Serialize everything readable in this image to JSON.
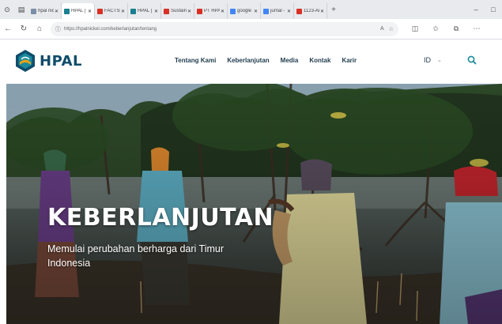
{
  "browser": {
    "tabs": [
      {
        "label": "hpal nick",
        "favicon_color": "#7a8ea6"
      },
      {
        "label": "HPAL | Ke",
        "favicon_color": "#1a7f8f",
        "active": true
      },
      {
        "label": "FACTSHE",
        "favicon_color": "#d93025"
      },
      {
        "label": "HPAL | Ke",
        "favicon_color": "#1a7f8f"
      },
      {
        "label": "Sustaina",
        "favicon_color": "#d93025"
      },
      {
        "label": "PT HPAL",
        "favicon_color": "#d93025"
      },
      {
        "label": "google s",
        "favicon_color": "#4285f4"
      },
      {
        "label": "jurnal - G",
        "favicon_color": "#4285f4"
      },
      {
        "label": "1123-Arti",
        "favicon_color": "#d93025"
      }
    ],
    "url": "https://hpalnickel.com/keberlanjutan/tentang",
    "new_tab_symbol": "+",
    "window_controls": [
      "–",
      "□"
    ]
  },
  "site": {
    "logo_text": "HPAL",
    "brand_colors": {
      "primary": "#0f4c6b",
      "accent": "#e8a317",
      "teal": "#1a8a9c"
    },
    "menu": [
      "Tentang Kami",
      "Keberlanjutan",
      "Media",
      "Kontak",
      "Karir"
    ],
    "language": "ID",
    "search_icon": "search-icon"
  },
  "hero": {
    "title": "KEBERLANJUTAN",
    "subtitle": "Memulai perubahan berharga dari Timur Indonesia"
  }
}
